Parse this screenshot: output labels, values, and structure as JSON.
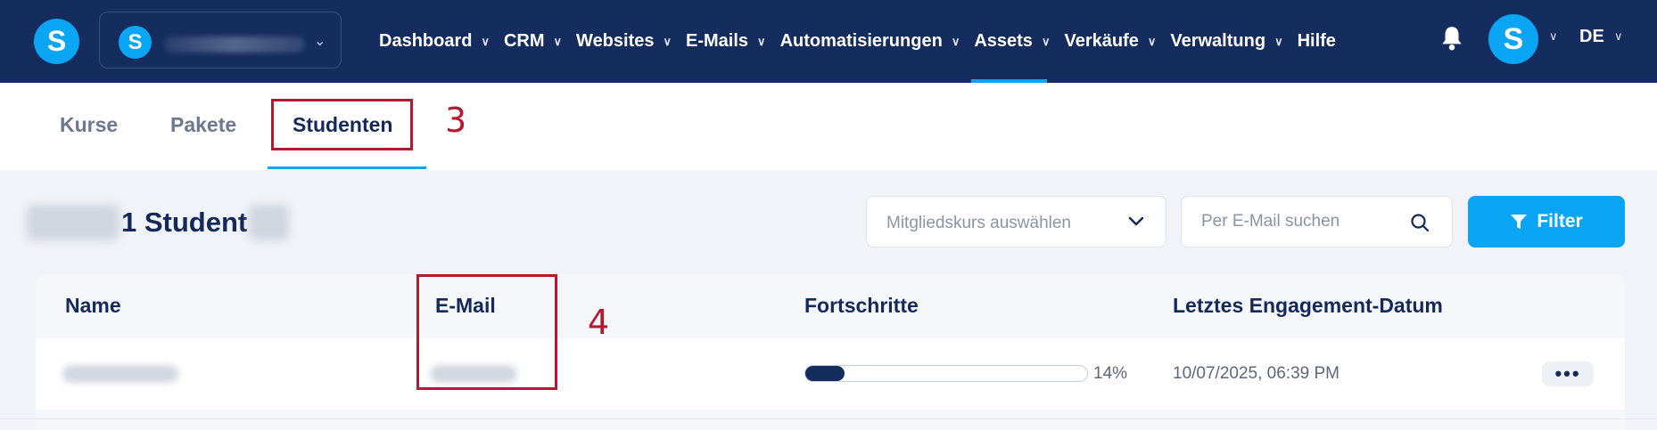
{
  "nav": {
    "brand_letter": "S",
    "account_avatar_letter": "S",
    "items": [
      {
        "label": "Dashboard"
      },
      {
        "label": "CRM"
      },
      {
        "label": "Websites"
      },
      {
        "label": "E-Mails"
      },
      {
        "label": "Automatisierungen"
      },
      {
        "label": "Assets"
      },
      {
        "label": "Verkäufe"
      },
      {
        "label": "Verwaltung"
      },
      {
        "label": "Hilfe"
      }
    ],
    "active_item": "Assets",
    "user_avatar_letter": "S",
    "language": "DE",
    "icons": {
      "notifications": "bell-icon",
      "dropdown": "chevron-down-icon"
    }
  },
  "subtabs": {
    "items": [
      {
        "label": "Kurse"
      },
      {
        "label": "Pakete"
      },
      {
        "label": "Studenten"
      }
    ],
    "active": "Studenten"
  },
  "annotations": {
    "tab_marker": "3",
    "email_marker": "4"
  },
  "toolbar": {
    "count_title": "1 Student",
    "course_select_placeholder": "Mitgliedskurs auswählen",
    "search_placeholder": "Per E-Mail suchen",
    "filter_label": "Filter",
    "icons": {
      "search": "search-icon",
      "filter": "filter-icon",
      "select": "chevron-down-icon"
    }
  },
  "table": {
    "columns": [
      "Name",
      "E-Mail",
      "Fortschritte",
      "Letztes Engagement-Datum"
    ],
    "rows": [
      {
        "progress": 0.14,
        "progress_label": "14%",
        "last_engagement": "10/07/2025, 06:39 PM",
        "actions_label": "•••"
      }
    ]
  },
  "colors": {
    "nav_bg": "#152c5e",
    "accent": "#0aa6f5",
    "annotation": "#b5182f"
  }
}
